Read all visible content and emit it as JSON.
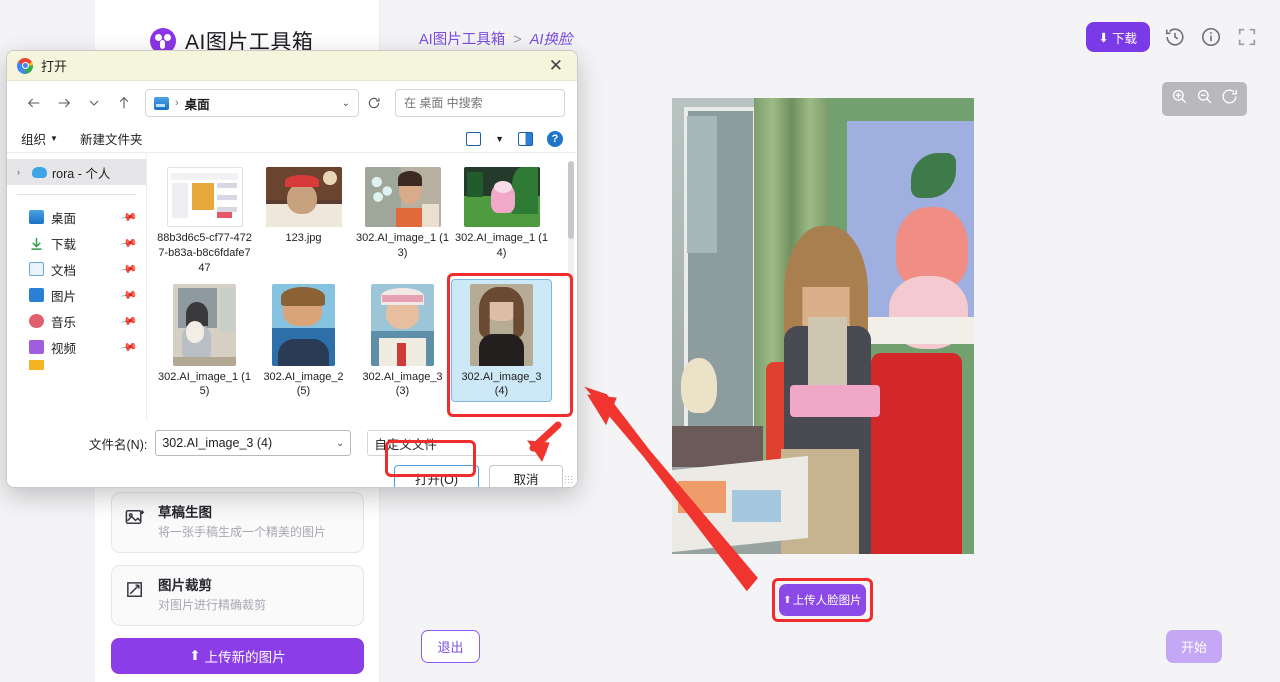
{
  "app": {
    "brand_title": "AI图片工具箱",
    "breadcrumb": {
      "root": "AI图片工具箱",
      "separator": ">",
      "current": "AI换脸"
    },
    "download_button": "下载",
    "icons": {
      "history": "history-icon",
      "info": "info-icon",
      "fullscreen": "fullscreen-icon",
      "zoom_in": "zoom-in-icon",
      "zoom_out": "zoom-out-icon",
      "reset": "reset-rotate-icon"
    },
    "left_panel": {
      "cards": [
        {
          "title": "草稿生图",
          "subtitle": "将一张手稿生成一个精美的图片",
          "icon": "image-sparkle-icon"
        },
        {
          "title": "图片裁剪",
          "subtitle": "对图片进行精确裁剪",
          "icon": "crop-icon"
        }
      ],
      "upload_new_button": "上传新的图片"
    },
    "exit_button": "退出",
    "start_button": "开始",
    "upload_face_button": "上传人脸图片"
  },
  "dialog": {
    "title": "打开",
    "close_label": "✕",
    "nav": {
      "back": "back-arrow-icon",
      "forward": "forward-arrow-icon",
      "recent": "chevron-down-icon",
      "up": "up-arrow-icon",
      "address_text": "桌面",
      "address_separator": "›",
      "refresh": "refresh-icon",
      "search_placeholder": "在 桌面 中搜索"
    },
    "toolbar": {
      "organize": "组织",
      "new_folder": "新建文件夹",
      "view_icon": "view-mode-icon",
      "view_caret": "chevron-down-icon",
      "preview_pane_icon": "preview-pane-icon",
      "help": "?"
    },
    "sidebar": {
      "root": {
        "label": "rora - 个人",
        "icon": "onedrive-cloud-icon"
      },
      "items": [
        {
          "label": "桌面",
          "icon": "desktop-icon",
          "color": "#3b86d8"
        },
        {
          "label": "下载",
          "icon": "downloads-icon",
          "color": "#2c9d4a"
        },
        {
          "label": "文档",
          "icon": "documents-icon",
          "color": "#6aa9e0"
        },
        {
          "label": "图片",
          "icon": "pictures-icon",
          "color": "#2b7fd4"
        },
        {
          "label": "音乐",
          "icon": "music-icon",
          "color": "#e0606f"
        },
        {
          "label": "视频",
          "icon": "videos-icon",
          "color": "#a05de0"
        }
      ]
    },
    "files": [
      {
        "name": "88b3d6c5-cf77-4727-b83a-b8c6fdafe747",
        "selected": false,
        "thumb": "screenshot"
      },
      {
        "name": "123.jpg",
        "selected": false,
        "thumb": "dog-santa"
      },
      {
        "name": "302.AI_image_1 (13)",
        "selected": false,
        "thumb": "woman-lights"
      },
      {
        "name": "302.AI_image_1 (14)",
        "selected": false,
        "thumb": "pink-bear-tree"
      },
      {
        "name": "302.AI_image_1 (15)",
        "selected": false,
        "thumb": "kitty-volcano"
      },
      {
        "name": "302.AI_image_2 (5)",
        "selected": false,
        "thumb": "boy-beach"
      },
      {
        "name": "302.AI_image_3 (3)",
        "selected": false,
        "thumb": "sailor-girl"
      },
      {
        "name": "302.AI_image_3 (4)",
        "selected": true,
        "thumb": "portrait-girl"
      }
    ],
    "footer": {
      "filename_label": "文件名(N):",
      "filename_value": "302.AI_image_3 (4)",
      "filetype_value": "自定义文件",
      "open_button": "打开(O)",
      "cancel_button": "取消"
    }
  },
  "annotations": {
    "highlight_color": "#f02d2d",
    "arrow_color": "#f0352f",
    "boxes": [
      "selected-file-box",
      "open-button-box",
      "upload-face-button-box"
    ],
    "arrows": [
      "arrow-upload-to-dialog",
      "arrow-to-open-button"
    ]
  }
}
